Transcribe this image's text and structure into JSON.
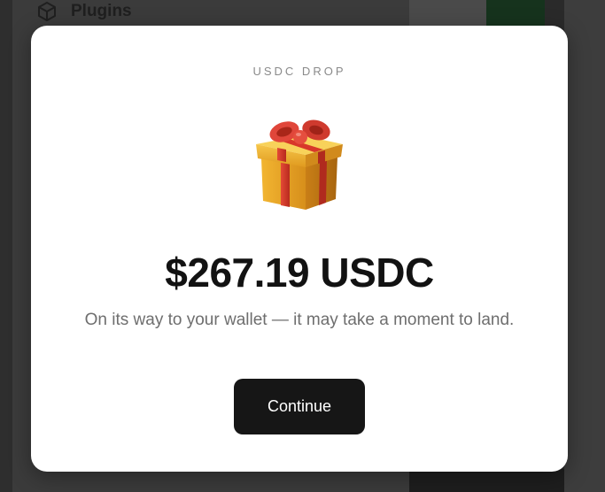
{
  "background": {
    "nav_label": "Plugins",
    "nav_icon": "cube-icon"
  },
  "modal": {
    "eyebrow": "USDC DROP",
    "icon": "gift-icon",
    "amount": "$267.19 USDC",
    "subtitle": "On its way to your wallet — it may take a moment to land.",
    "button_label": "Continue"
  },
  "colors": {
    "modal_bg": "#ffffff",
    "button_bg": "#161616",
    "backdrop": "#3b3b3b",
    "gift_box": "#e8a92a",
    "gift_ribbon": "#d93a2b"
  }
}
